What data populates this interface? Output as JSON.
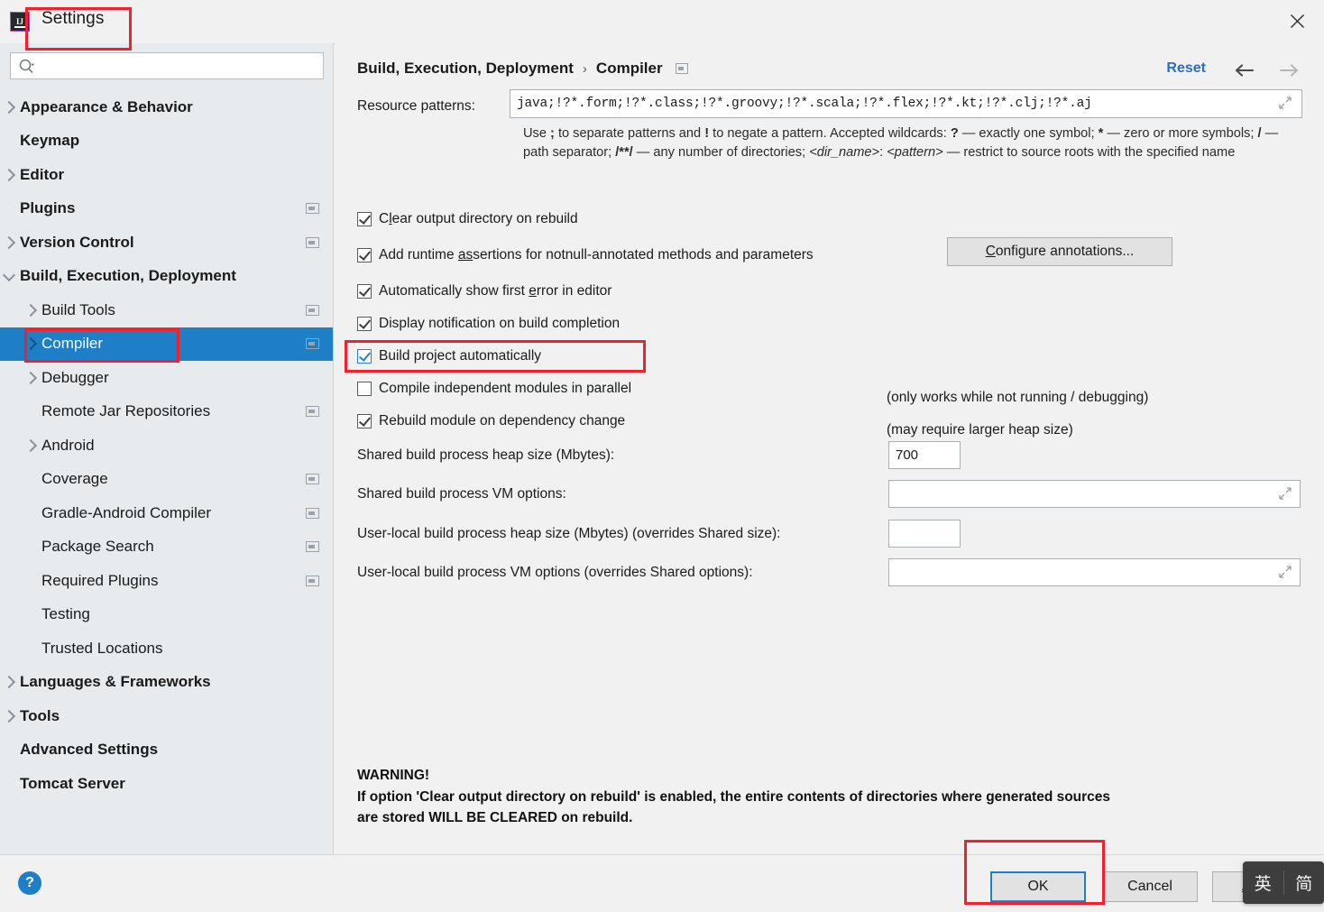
{
  "window": {
    "title": "Settings",
    "logo_text": "IJ",
    "close_icon": "close-icon"
  },
  "search": {
    "value": "",
    "placeholder": "",
    "icon": "search-icon"
  },
  "sidebar": {
    "items": [
      {
        "label": "Appearance & Behavior",
        "chevron": "right",
        "bold": true,
        "indent": 0,
        "badge": false,
        "selected": false
      },
      {
        "label": "Keymap",
        "chevron": "none",
        "bold": true,
        "indent": 0,
        "badge": false,
        "selected": false
      },
      {
        "label": "Editor",
        "chevron": "right",
        "bold": true,
        "indent": 0,
        "badge": false,
        "selected": false
      },
      {
        "label": "Plugins",
        "chevron": "none",
        "bold": true,
        "indent": 0,
        "badge": true,
        "selected": false
      },
      {
        "label": "Version Control",
        "chevron": "right",
        "bold": true,
        "indent": 0,
        "badge": true,
        "selected": false
      },
      {
        "label": "Build, Execution, Deployment",
        "chevron": "down",
        "bold": true,
        "indent": 0,
        "badge": false,
        "selected": false
      },
      {
        "label": "Build Tools",
        "chevron": "right",
        "bold": false,
        "indent": 1,
        "badge": true,
        "selected": false
      },
      {
        "label": "Compiler",
        "chevron": "right",
        "bold": false,
        "indent": 1,
        "badge": true,
        "selected": true
      },
      {
        "label": "Debugger",
        "chevron": "right",
        "bold": false,
        "indent": 1,
        "badge": false,
        "selected": false
      },
      {
        "label": "Remote Jar Repositories",
        "chevron": "none",
        "bold": false,
        "indent": 1,
        "badge": true,
        "selected": false
      },
      {
        "label": "Android",
        "chevron": "right",
        "bold": false,
        "indent": 1,
        "badge": false,
        "selected": false
      },
      {
        "label": "Coverage",
        "chevron": "none",
        "bold": false,
        "indent": 1,
        "badge": true,
        "selected": false
      },
      {
        "label": "Gradle-Android Compiler",
        "chevron": "none",
        "bold": false,
        "indent": 1,
        "badge": true,
        "selected": false
      },
      {
        "label": "Package Search",
        "chevron": "none",
        "bold": false,
        "indent": 1,
        "badge": true,
        "selected": false
      },
      {
        "label": "Required Plugins",
        "chevron": "none",
        "bold": false,
        "indent": 1,
        "badge": true,
        "selected": false
      },
      {
        "label": "Testing",
        "chevron": "none",
        "bold": false,
        "indent": 1,
        "badge": false,
        "selected": false
      },
      {
        "label": "Trusted Locations",
        "chevron": "none",
        "bold": false,
        "indent": 1,
        "badge": false,
        "selected": false
      },
      {
        "label": "Languages & Frameworks",
        "chevron": "right",
        "bold": true,
        "indent": 0,
        "badge": false,
        "selected": false
      },
      {
        "label": "Tools",
        "chevron": "right",
        "bold": true,
        "indent": 0,
        "badge": false,
        "selected": false
      },
      {
        "label": "Advanced Settings",
        "chevron": "none",
        "bold": true,
        "indent": 0,
        "badge": false,
        "selected": false
      },
      {
        "label": "Tomcat Server",
        "chevron": "none",
        "bold": true,
        "indent": 0,
        "badge": false,
        "selected": false
      }
    ]
  },
  "header": {
    "crumb_root": "Build, Execution, Deployment",
    "crumb_sep": "›",
    "crumb_leaf": "Compiler",
    "reset_label": "Reset",
    "back_icon": "arrow-left-icon",
    "forward_icon": "arrow-right-icon"
  },
  "main": {
    "resource_patterns_label": "Resource patterns:",
    "resource_patterns_value": "java;!?*.form;!?*.class;!?*.groovy;!?*.scala;!?*.flex;!?*.kt;!?*.clj;!?*.aj",
    "hint_line1_a": "Use ",
    "hint_sep": ";",
    "hint_line1_b": " to separate patterns and ",
    "hint_bang": "!",
    "hint_line1_c": " to negate a pattern. Accepted wildcards: ",
    "hint_q": "?",
    "hint_line1_d": " — exactly one symbol; ",
    "hint_star": "*",
    "hint_line1_e": " — zero or",
    "hint_line2_a": "more symbols; ",
    "hint_slash": "/",
    "hint_line2_b": " — path separator; ",
    "hint_globstar": "/**/",
    "hint_line2_c": " — any number of directories; ",
    "hint_dirname": "<dir_name>",
    "hint_colon": ": ",
    "hint_pattern": "<pattern>",
    "hint_line2_d": " — restrict to",
    "hint_line3": "source roots with the specified name",
    "checkboxes": [
      {
        "label_pre": "C",
        "label_mnemonic": "l",
        "label_post": "ear output directory on rebuild",
        "checked": true,
        "focused": false
      },
      {
        "label_pre": "Add runtime ",
        "label_mnemonic": "as",
        "label_post": "sertions for notnull-annotated methods and parameters",
        "checked": true,
        "focused": false
      },
      {
        "label_pre": "Automatically show first ",
        "label_mnemonic": "e",
        "label_post": "rror in editor",
        "checked": true,
        "focused": false
      },
      {
        "label_pre": "Display notification on build completion",
        "label_mnemonic": "",
        "label_post": "",
        "checked": true,
        "focused": false
      },
      {
        "label_pre": "Build project automatically",
        "label_mnemonic": "",
        "label_post": "",
        "checked": true,
        "focused": true
      },
      {
        "label_pre": "Compile independent modules in parallel",
        "label_mnemonic": "",
        "label_post": "",
        "checked": false,
        "focused": false
      },
      {
        "label_pre": "Rebuild module on dependency change",
        "label_mnemonic": "",
        "label_post": "",
        "checked": true,
        "focused": false
      }
    ],
    "configure_annotations_mnemonic": "C",
    "configure_annotations_rest": "onfigure annotations...",
    "note_build_auto": "(only works while not running / debugging)",
    "note_parallel": "(may require larger heap size)",
    "shared_heap_label": "Shared build process heap size (Mbytes):",
    "shared_heap_value": "700",
    "shared_vm_label": "Shared build process VM options:",
    "shared_vm_value": "",
    "userlocal_heap_label": "User-local build process heap size (Mbytes) (overrides Shared size):",
    "userlocal_heap_value": "",
    "userlocal_vm_label": "User-local build process VM options (overrides Shared options):",
    "userlocal_vm_value": "",
    "warning_title": "WARNING!",
    "warning_line1": "If option 'Clear output directory on rebuild' is enabled, the entire contents of directories where generated sources",
    "warning_line2": "are stored WILL BE CLEARED on rebuild."
  },
  "footer": {
    "help_label": "?",
    "ok_label": "OK",
    "cancel_label": "Cancel",
    "apply_mnemonic": "A",
    "apply_rest": "pply"
  },
  "ime": {
    "mode_language": "英",
    "mode_shape": "简"
  },
  "colors": {
    "accent_blue": "#1e7fc6",
    "link_blue": "#2a6ec4",
    "annotation_red": "#f3212e",
    "sidebar_bg": "#e7ebee",
    "panel_bg": "#f1f1f1"
  }
}
